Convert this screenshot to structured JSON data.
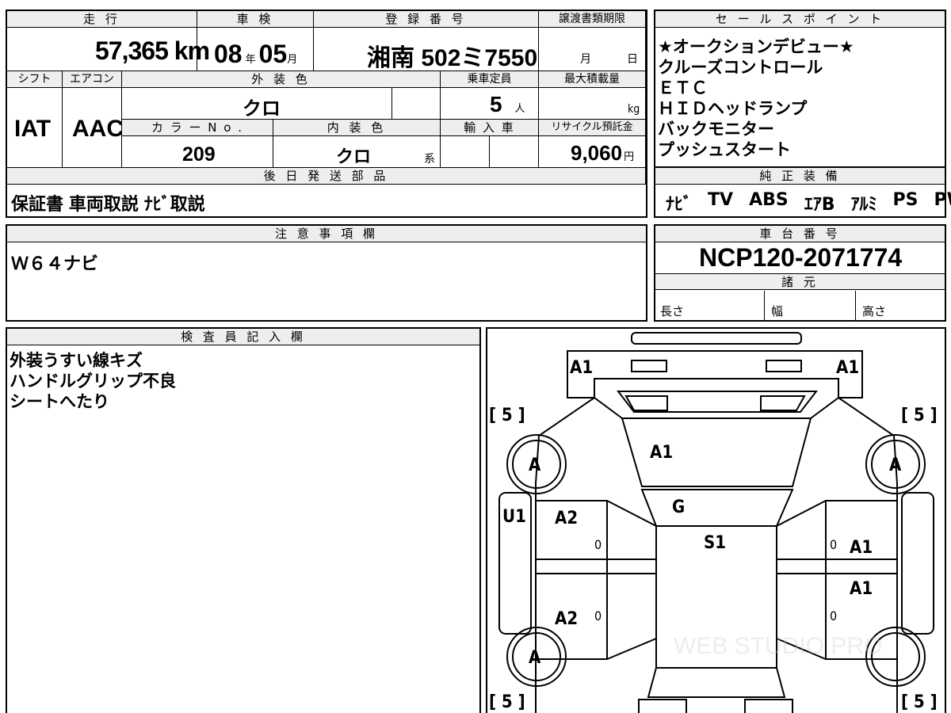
{
  "top_left": {
    "headers": {
      "mileage": "走 行",
      "inspection": "車 検",
      "registration": "登 録 番 号",
      "transfer_deadline": "譲渡書類期限"
    },
    "mileage_value": "57,365",
    "mileage_unit": "km",
    "inspection_year": "08",
    "inspection_year_unit": "年",
    "inspection_month": "05",
    "inspection_month_unit": "月",
    "registration_value": "湘南 502ミ7550",
    "transfer_month_unit": "月",
    "transfer_day_unit": "日",
    "headers2": {
      "shift": "シフト",
      "aircon": "エアコン",
      "exterior_color": "外 装 色",
      "capacity": "乗車定員",
      "max_load": "最大積載量",
      "color_no": "カ ラ ー N o .",
      "interior_color": "内 装 色",
      "import": "輸 入 車",
      "recycle": "リサイクル預託金"
    },
    "shift_value": "IAT",
    "aircon_value": "AAC",
    "exterior_color_value": "クロ",
    "capacity_value": "5",
    "capacity_unit": "人",
    "max_load_unit": "kg",
    "color_no_value": "209",
    "interior_color_value": "クロ",
    "interior_color_unit": "系",
    "recycle_value": "9,060",
    "recycle_unit": "円",
    "later_parts_header": "後 日 発 送 部 品",
    "later_parts_value": "保証書 車両取説 ﾅﾋﾞ取説"
  },
  "sales_points": {
    "header": "セ ー ル ス ポ イ ン ト",
    "items": [
      "★オークションデビュー★",
      "クルーズコントロール",
      "ＥＴＣ",
      "ＨＩＤヘッドランプ",
      "バックモニター",
      "プッシュスタート"
    ]
  },
  "genuine_equipment": {
    "header": "純 正 装 備",
    "items": [
      "ﾅﾋﾞ",
      "TV",
      "ABS",
      "ｴｱB",
      "ｱﾙﾐ",
      "PS",
      "PW"
    ]
  },
  "notes": {
    "header": "注 意 事 項 欄",
    "value": "Ｗ６４ナビ"
  },
  "chassis": {
    "header": "車 台 番 号",
    "value": "NCP120-2071774",
    "specs_header": "諸 元",
    "length_label": "長さ",
    "width_label": "幅",
    "height_label": "高さ"
  },
  "inspector": {
    "header": "検 査 員 記 入 欄",
    "lines": [
      "外装うすい線キズ",
      "ハンドルグリップ不良",
      "シートへたり"
    ]
  },
  "diagram": {
    "labels": {
      "front_left_a1": "A1",
      "front_right_a1": "A1",
      "hood_a1": "A1",
      "windshield_g": "G",
      "roof_s1": "S1",
      "left_u1": "U1",
      "left_front_door_a2": "A2",
      "left_rear_door_a2": "A2",
      "right_front_door_a1": "A1",
      "right_rear_door_a1": "A1",
      "tire_fl": "A",
      "tire_fr": "A",
      "tire_rl": "A",
      "door_marks": [
        "0",
        "0",
        "0",
        "0"
      ],
      "bracket_tl": "[ 5 ]",
      "bracket_tr": "[ 5 ]",
      "bracket_bl": "[ 5 ]",
      "bracket_br": "[ 5 ]"
    }
  }
}
